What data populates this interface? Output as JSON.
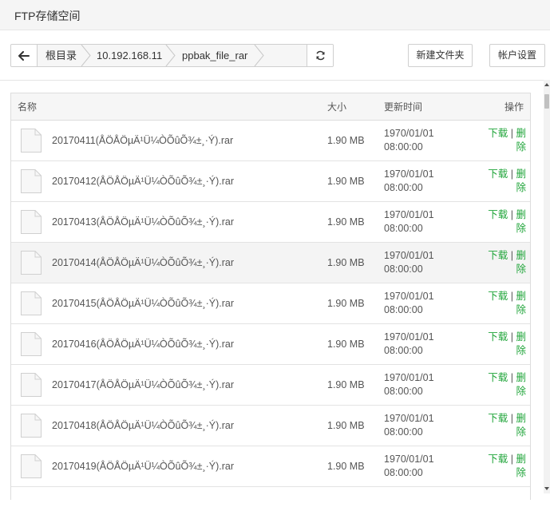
{
  "window": {
    "title": "FTP存储空间"
  },
  "breadcrumb": {
    "items": [
      {
        "label": "根目录"
      },
      {
        "label": "10.192.168.11"
      },
      {
        "label": "ppbak_file_rar"
      }
    ]
  },
  "toolbar": {
    "new_folder_label": "新建文件夹",
    "account_settings_label": "帐户设置"
  },
  "icons": {
    "back": "arrow-left-icon",
    "refresh": "refresh-icon",
    "file": "file-icon"
  },
  "colors": {
    "accent": "#20a53a"
  },
  "table": {
    "columns": {
      "name": "名称",
      "size": "大小",
      "time": "更新时间",
      "op": "操作"
    },
    "actions": {
      "download": "下载",
      "separator": "|",
      "delete_1": "删",
      "delete_2": "除"
    },
    "rows": [
      {
        "name": "20170411(ÅÖÅÖµÄ¹Ü¼ÒÕûÕ¾±¸·Ý).rar",
        "size": "1.90 MB",
        "date": "1970/01/01",
        "time": "08:00:00"
      },
      {
        "name": "20170412(ÅÖÅÖµÄ¹Ü¼ÒÕûÕ¾±¸·Ý).rar",
        "size": "1.90 MB",
        "date": "1970/01/01",
        "time": "08:00:00"
      },
      {
        "name": "20170413(ÅÖÅÖµÄ¹Ü¼ÒÕûÕ¾±¸·Ý).rar",
        "size": "1.90 MB",
        "date": "1970/01/01",
        "time": "08:00:00"
      },
      {
        "name": "20170414(ÅÖÅÖµÄ¹Ü¼ÒÕûÕ¾±¸·Ý).rar",
        "size": "1.90 MB",
        "date": "1970/01/01",
        "time": "08:00:00"
      },
      {
        "name": "20170415(ÅÖÅÖµÄ¹Ü¼ÒÕûÕ¾±¸·Ý).rar",
        "size": "1.90 MB",
        "date": "1970/01/01",
        "time": "08:00:00"
      },
      {
        "name": "20170416(ÅÖÅÖµÄ¹Ü¼ÒÕûÕ¾±¸·Ý).rar",
        "size": "1.90 MB",
        "date": "1970/01/01",
        "time": "08:00:00"
      },
      {
        "name": "20170417(ÅÖÅÖµÄ¹Ü¼ÒÕûÕ¾±¸·Ý).rar",
        "size": "1.90 MB",
        "date": "1970/01/01",
        "time": "08:00:00"
      },
      {
        "name": "20170418(ÅÖÅÖµÄ¹Ü¼ÒÕûÕ¾±¸·Ý).rar",
        "size": "1.90 MB",
        "date": "1970/01/01",
        "time": "08:00:00"
      },
      {
        "name": "20170419(ÅÖÅÖµÄ¹Ü¼ÒÕûÕ¾±¸·Ý).rar",
        "size": "1.90 MB",
        "date": "1970/01/01",
        "time": "08:00:00"
      }
    ]
  }
}
